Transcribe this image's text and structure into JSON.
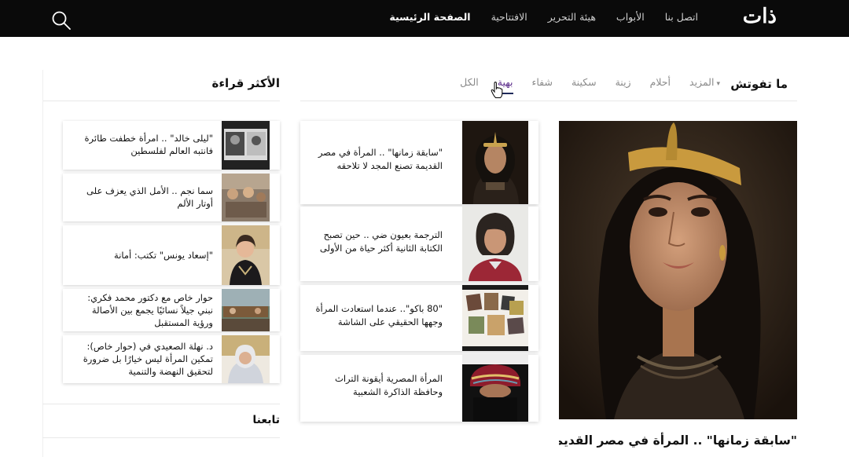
{
  "header": {
    "logo": "ذات",
    "nav": [
      {
        "label": "الصفحة الرئيسية",
        "active": true
      },
      {
        "label": "الافتتاحية",
        "active": false
      },
      {
        "label": "هيئة التحرير",
        "active": false
      },
      {
        "label": "الأبواب",
        "active": false
      },
      {
        "label": "اتصل بنا",
        "active": false
      }
    ],
    "search_icon": "search-icon"
  },
  "section": {
    "title": "ما تفوتش",
    "tabs": [
      "الكل",
      "بهية",
      "شفاء",
      "سكينة",
      "زينة",
      "أحلام",
      "المزيد"
    ],
    "active_tab": "بهية"
  },
  "most_read": {
    "title": "الأكثر قراءة",
    "items": [
      {
        "title": "\"ليلى خالد\" .. امرأة خطفت طائرة فانتبه العالم لفلسطين"
      },
      {
        "title": "سما نجم .. الأمل الذي يعزف على أوتار الألم"
      },
      {
        "title": "\"إسعاد يونس\" تكتب: أمانة"
      },
      {
        "title": "حوار خاص مع دكتور محمد فكري: نبني جيلاً نسائيًا يجمع بين الأصالة ورؤية المستقبل"
      },
      {
        "title": "د. نهلة الصعيدي في (حوار خاص): تمكين المرأة ليس خيارًا بل ضرورة لتحقيق النهضة والتنمية"
      }
    ],
    "follow_title": "تابعنا"
  },
  "cards": [
    {
      "title": "\"سابقة زمانها\" .. المرأة في مصر القديمة تصنع المجد لا تلاحقه"
    },
    {
      "title": "الترجمة بعيون ضي .. حين تصبح الكتابة الثانية أكثر حياة من الأولى"
    },
    {
      "title": "\"80 باكو\".. عندما استعادت المرأة وجهها الحقيقي على الشاشة"
    },
    {
      "title": "المرأة المصرية أيقونة التراث وحافظة الذاكرة الشعبية"
    }
  ],
  "featured": {
    "caption": "\"سابقة زمانها\" .. المرأة في مصر القديمة تصنع المجد لا تلاحقه"
  }
}
